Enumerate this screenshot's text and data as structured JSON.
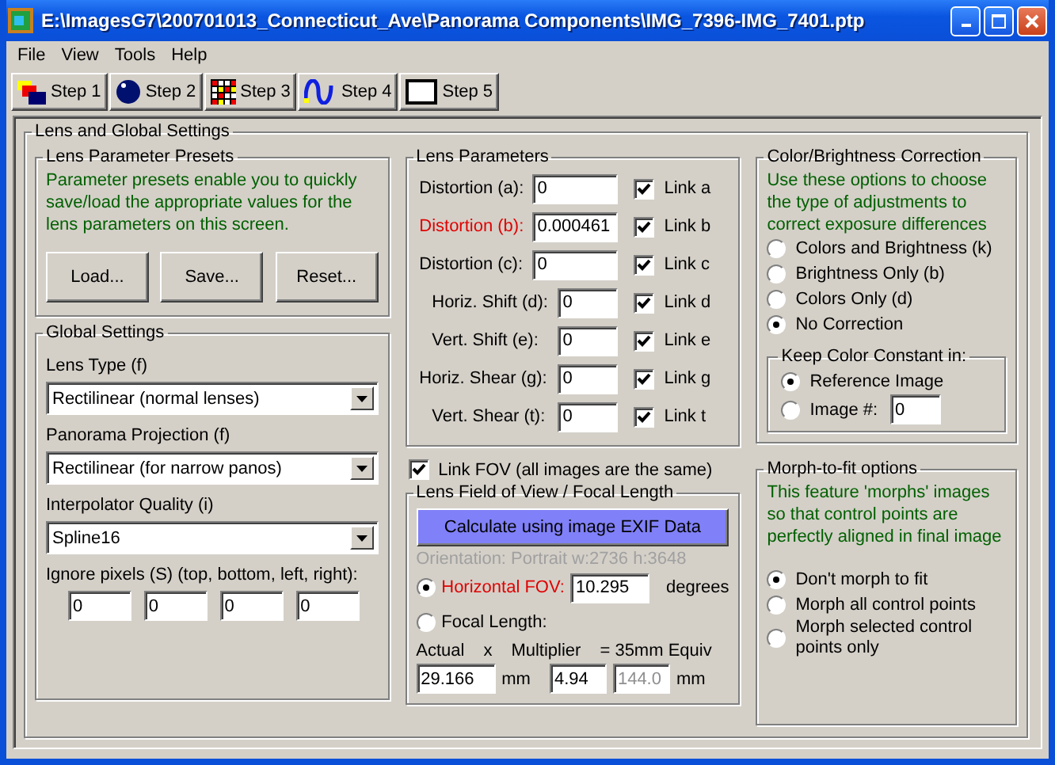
{
  "window": {
    "title": "E:\\ImagesG7\\200701013_Connecticut_Ave\\Panorama Components\\IMG_7396-IMG_7401.ptp"
  },
  "menu": [
    "File",
    "View",
    "Tools",
    "Help"
  ],
  "steps": [
    "Step 1",
    "Step 2",
    "Step 3",
    "Step 4",
    "Step 5"
  ],
  "panel": {
    "title": "Lens and Global Settings"
  },
  "presets": {
    "title": "Lens Parameter Presets",
    "description": "Parameter presets enable you to quickly save/load the appropriate values for the lens parameters on this screen.",
    "buttons": [
      "Load...",
      "Save...",
      "Reset..."
    ]
  },
  "global": {
    "title": "Global Settings",
    "dropdowns": [
      {
        "label": "Lens Type (f)",
        "value": "Rectilinear (normal lenses)"
      },
      {
        "label": "Panorama Projection (f)",
        "value": "Rectilinear (for narrow panos)"
      },
      {
        "label": "Interpolator Quality (i)",
        "value": "Spline16"
      }
    ],
    "ignore_label": "Ignore pixels (S) (top, bottom, left, right):",
    "ignore_values": [
      "0",
      "0",
      "0",
      "0"
    ]
  },
  "lens": {
    "title": "Lens Parameters",
    "rows": [
      {
        "label": "Distortion (a):",
        "value": "0",
        "link": "Link a",
        "checked": true,
        "highlighted": false
      },
      {
        "label": "Distortion (b):",
        "value": "0.000461",
        "link": "Link b",
        "checked": true,
        "highlighted": true
      },
      {
        "label": "Distortion (c):",
        "value": "0",
        "link": "Link c",
        "checked": true,
        "highlighted": false
      },
      {
        "label": "Horiz. Shift (d):",
        "value": "0",
        "link": "Link d",
        "checked": true,
        "highlighted": false
      },
      {
        "label": "Vert. Shift (e):",
        "value": "0",
        "link": "Link e",
        "checked": true,
        "highlighted": false
      },
      {
        "label": "Horiz. Shear (g):",
        "value": "0",
        "link": "Link g",
        "checked": true,
        "highlighted": false
      },
      {
        "label": "Vert. Shear (t):",
        "value": "0",
        "link": "Link t",
        "checked": true,
        "highlighted": false
      }
    ],
    "link_fov": {
      "label": "Link FOV (all images are the same)",
      "checked": true
    }
  },
  "fov": {
    "title": "Lens Field of View / Focal Length",
    "button": "Calculate using image EXIF Data",
    "orientation": "Orientation: Portrait w:2736 h:3648",
    "horizontal": {
      "label": "Horizontal FOV:",
      "selected": true,
      "value": "10.295",
      "unit": "degrees"
    },
    "focal": {
      "label": "Focal Length:",
      "selected": false
    },
    "headers": [
      "Actual",
      "x",
      "Multiplier",
      "= 35mm Equiv"
    ],
    "actual": "29.166",
    "actual_unit": "mm",
    "multiplier": "4.94",
    "equiv": "144.0",
    "equiv_unit": "mm"
  },
  "color": {
    "title": "Color/Brightness Correction",
    "description": "Use these options to choose the type of adjustments to correct exposure differences",
    "options": [
      {
        "label": "Colors and Brightness (k)",
        "selected": false
      },
      {
        "label": "Brightness Only (b)",
        "selected": false
      },
      {
        "label": "Colors Only (d)",
        "selected": false
      },
      {
        "label": "No Correction",
        "selected": true
      }
    ],
    "keep": {
      "title": "Keep Color Constant in:",
      "reference": {
        "label": "Reference Image",
        "selected": true
      },
      "image": {
        "label": "Image #:",
        "selected": false,
        "value": "0"
      }
    }
  },
  "morph": {
    "title": "Morph-to-fit options",
    "description": "This feature 'morphs' images so that control points are perfectly aligned in final image",
    "options": [
      {
        "label": "Don't morph to fit",
        "selected": true
      },
      {
        "label": "Morph all control points",
        "selected": false
      },
      {
        "label": "Morph selected control points only",
        "selected": false
      }
    ]
  }
}
